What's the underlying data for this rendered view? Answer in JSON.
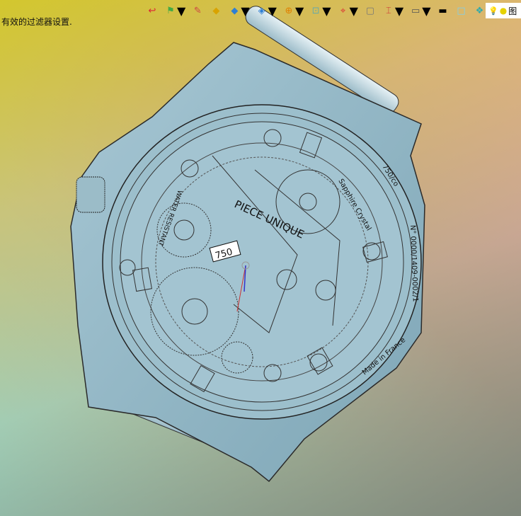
{
  "status_message": "有效的过滤器设置.",
  "toolbar": {
    "items": [
      {
        "name": "exit-icon",
        "glyph": "↩",
        "color": "#d23"
      },
      {
        "name": "view-orient-icon",
        "glyph": "⚑",
        "color": "#4a4"
      },
      {
        "name": "brush-icon",
        "glyph": "✎",
        "color": "#c44"
      },
      {
        "name": "cube-yellow-icon",
        "glyph": "◆",
        "color": "#d9a300"
      },
      {
        "name": "cube-blue-icon",
        "glyph": "◆",
        "color": "#2f7fd3"
      },
      {
        "name": "cube-section-icon",
        "glyph": "◈",
        "color": "#2f7fd3"
      },
      {
        "name": "display-style-icon",
        "glyph": "⊕",
        "color": "#e08000"
      },
      {
        "name": "zoom-fit-icon",
        "glyph": "⊡",
        "color": "#6aa"
      },
      {
        "name": "crosshair-icon",
        "glyph": "⌖",
        "color": "#d33"
      },
      {
        "name": "frame-icon",
        "glyph": "▢",
        "color": "#777"
      },
      {
        "name": "measure-icon",
        "glyph": "⌶",
        "color": "#c33"
      },
      {
        "name": "monitor-icon",
        "glyph": "▭",
        "color": "#555"
      },
      {
        "name": "color-black-icon",
        "glyph": "▬",
        "color": "#000"
      },
      {
        "name": "color-swatch-icon",
        "glyph": "□",
        "color": "#7fd0ef"
      },
      {
        "name": "layers-icon",
        "glyph": "❖",
        "color": "#3aa"
      }
    ],
    "right": {
      "bulb": "💡",
      "dot": "●",
      "char": "图"
    }
  },
  "watch": {
    "case_back_text_1": "PIECE UNIQUE",
    "case_back_text_2": "WATER RESISTANT",
    "case_back_text_3": "Sapphire Crystal",
    "serial": "N° 0000/1409-0002/1",
    "hallmark": "750/co",
    "origin": "Made in France",
    "gold_mark": "750"
  }
}
